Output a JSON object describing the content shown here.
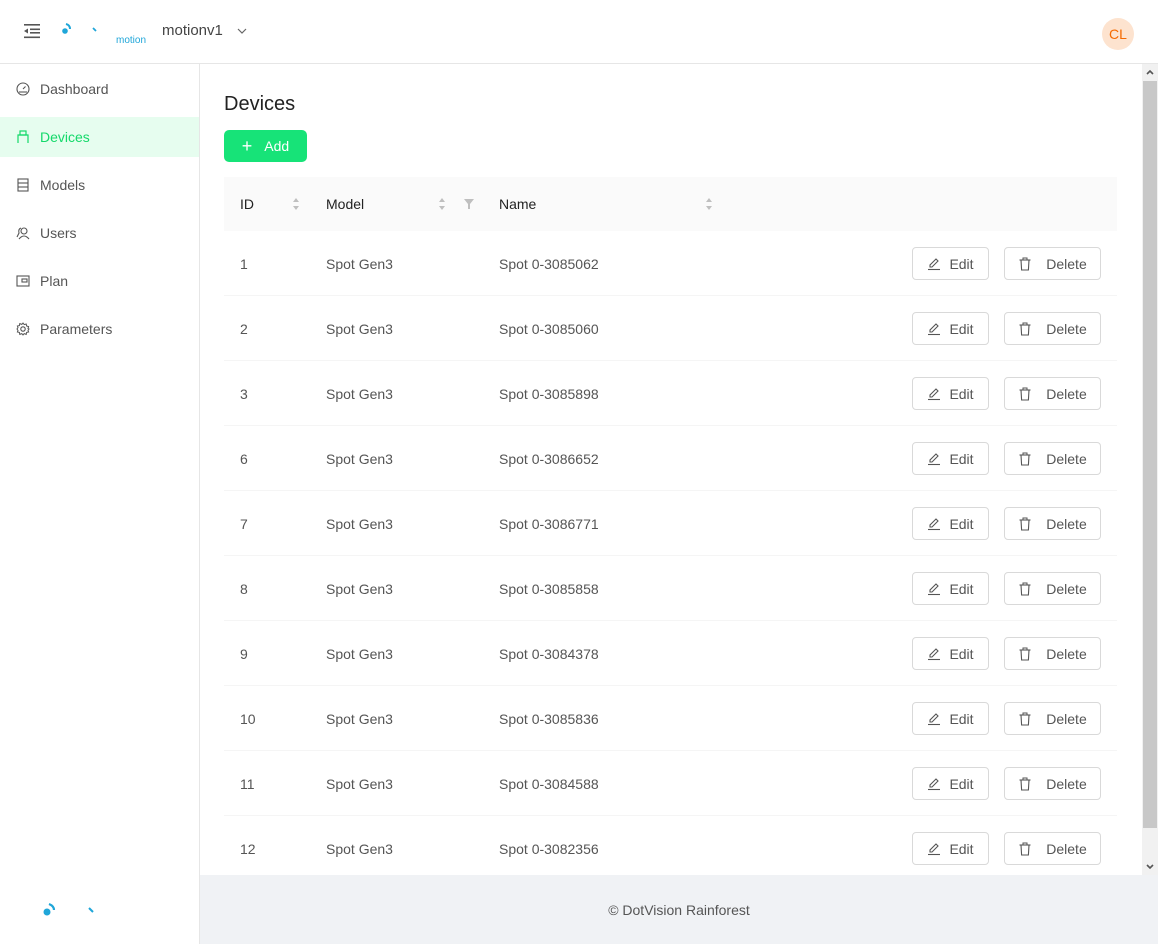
{
  "header": {
    "logo_text": "motion",
    "project": "motionv1",
    "avatar_initials": "CL"
  },
  "colors": {
    "accent": "#17e378",
    "accent_light_bg": "#e6fdef",
    "logo_blue": "#1fa6d9",
    "avatar_bg": "#fde3cf",
    "avatar_fg": "#f56a00",
    "footer_bg": "#f0f2f5"
  },
  "sidebar": {
    "items": [
      {
        "label": "Dashboard",
        "icon": "dashboard-icon",
        "active": false
      },
      {
        "label": "Devices",
        "icon": "usb-icon",
        "active": true
      },
      {
        "label": "Models",
        "icon": "database-icon",
        "active": false
      },
      {
        "label": "Users",
        "icon": "users-icon",
        "active": false
      },
      {
        "label": "Plan",
        "icon": "wallet-icon",
        "active": false
      },
      {
        "label": "Parameters",
        "icon": "gear-icon",
        "active": false
      }
    ]
  },
  "main": {
    "title": "Devices",
    "add_label": "Add",
    "table": {
      "columns": [
        {
          "label": "ID",
          "sortable": true
        },
        {
          "label": "Model",
          "sortable": true,
          "filterable": true
        },
        {
          "label": "Name",
          "sortable": true
        }
      ],
      "rows": [
        {
          "id": "1",
          "model": "Spot Gen3",
          "name": "Spot 0-3085062"
        },
        {
          "id": "2",
          "model": "Spot Gen3",
          "name": "Spot 0-3085060"
        },
        {
          "id": "3",
          "model": "Spot Gen3",
          "name": "Spot 0-3085898"
        },
        {
          "id": "6",
          "model": "Spot Gen3",
          "name": "Spot 0-3086652"
        },
        {
          "id": "7",
          "model": "Spot Gen3",
          "name": "Spot 0-3086771"
        },
        {
          "id": "8",
          "model": "Spot Gen3",
          "name": "Spot 0-3085858"
        },
        {
          "id": "9",
          "model": "Spot Gen3",
          "name": "Spot 0-3084378"
        },
        {
          "id": "10",
          "model": "Spot Gen3",
          "name": "Spot 0-3085836"
        },
        {
          "id": "11",
          "model": "Spot Gen3",
          "name": "Spot 0-3084588"
        },
        {
          "id": "12",
          "model": "Spot Gen3",
          "name": "Spot 0-3082356"
        }
      ],
      "edit_label": "Edit",
      "delete_label": "Delete"
    }
  },
  "footer": {
    "text": "© DotVision Rainforest"
  }
}
